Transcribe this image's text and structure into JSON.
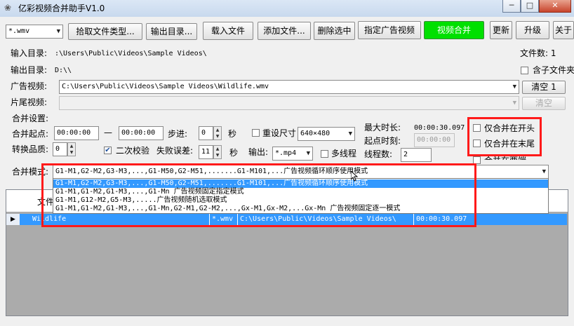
{
  "window": {
    "title": "亿彩视频合并助手V1.0",
    "min_label": "─",
    "max_label": "□",
    "close_label": "✕",
    "app_icon": "app-logo-icon"
  },
  "toolbar": {
    "filetype_value": "*.wmv",
    "pick_type": "拾取文件类型...",
    "output_dir": "输出目录...",
    "load_file": "载入文件",
    "add_file": "添加文件...",
    "delete_selected": "删除选中",
    "set_ad_video": "指定广告视频",
    "merge_video": "视频合并",
    "update": "更新",
    "upgrade": "升级",
    "about": "关于"
  },
  "form": {
    "input_dir_label": "输入目录:",
    "input_dir_value": ":\\Users\\Public\\Videos\\Sample Videos\\",
    "file_count": "文件数: 1",
    "output_dir_label": "输出目录:",
    "output_dir_value": "D:\\\\",
    "include_subfolders": "含子文件夹",
    "ad_video_label": "广告视频:",
    "ad_video_value": "C:\\Users\\Public\\Videos\\Sample Videos\\Wildlife.wmv",
    "clear1": "清空 1",
    "tail_video_label": "片尾视频:",
    "clear2": "清空",
    "merge_settings": "合并设置:",
    "merge_start_label": "合并起点:",
    "start_time": "00:00:00",
    "dash": "—",
    "end_time": "00:00:00",
    "step_label": "步进:",
    "step_value": "0",
    "sec1": "秒",
    "resize_label": "重设尺寸",
    "resize_value": "640×480",
    "max_duration_label": "最大时长:",
    "max_duration_value": "00:00:30.097",
    "merge_at_start": "仅合并在开头",
    "quality_label": "转换品质:",
    "quality_value": "0",
    "second_check": "二次校验",
    "fail_error_label": "失败误差:",
    "fail_error_value": "11",
    "sec2": "秒",
    "output_label": "输出:",
    "output_format": "*.mp4",
    "multithread": "多线程",
    "thread_count_label": "线程数:",
    "thread_count_value": "2",
    "start_time_label": "起点时刻:",
    "start_time_field": "00:00:00",
    "merge_at_end": "仅合并在末尾",
    "merge_inside": "合并在两端",
    "merge_mode_label": "合并模式:",
    "merge_mode_value": "G1-M1,G2-M2,G3-M3,...,G1-M50,G2-M51,.......G1-M101,...广告视频循环顺序使用模式"
  },
  "dropdown_options": [
    "G1-M1,G2-M2,G3-M3,...,G1-M50,G2-M51,.......G1-M101,...广告视频循环顺序使用模式",
    "G1-M1,G1-M2,G1-M3,...,G1-Mn 广告视频固定指定模式",
    "G1-M1,G12-M2,G5-M3,.....广告视频随机选取模式",
    "G1-M1,G1-M2,G1-M3,...,G1-Mn,G2-M1,G2-M2,...,Gx-M1,Gx-M2,...Gx-Mn 广告视频固定逐一模式"
  ],
  "table": {
    "header_partial": "文件",
    "rows": [
      {
        "name": "Wildlife",
        "ext": "*.wmv",
        "path": "C:\\Users\\Public\\Videos\\Sample Videos\\",
        "duration": "00:00:30.097"
      }
    ],
    "row_indicator": "▶"
  },
  "colors": {
    "highlight": "#3399ff",
    "merge_button": "#00e000",
    "annotation_red": "#ff1a1a"
  }
}
